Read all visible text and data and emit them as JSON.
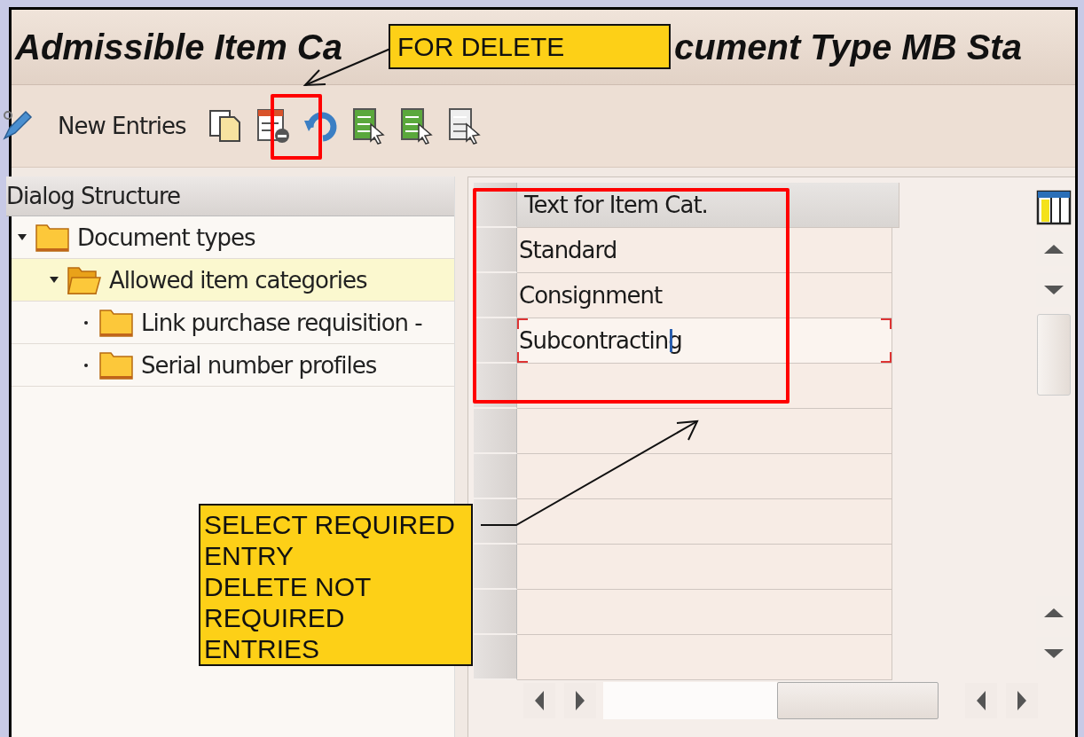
{
  "title": {
    "start": "Admissible Item Ca",
    "end": "cument Type MB Sta"
  },
  "toolbar": {
    "new_entries": "New Entries"
  },
  "dialog_structure": {
    "title": "Dialog Structure",
    "tree": [
      {
        "label": "Document types",
        "expanded": true,
        "selected": false,
        "children": [
          {
            "label": "Allowed item categories",
            "expanded": true,
            "selected": true,
            "children": [
              {
                "label": "Link purchase requisition -",
                "expanded": false,
                "selected": false
              },
              {
                "label": "Serial number profiles",
                "expanded": false,
                "selected": false
              }
            ]
          }
        ]
      }
    ]
  },
  "table": {
    "columns": [
      "Text for Item Cat."
    ],
    "rows": [
      {
        "text": "Standard",
        "focused": false
      },
      {
        "text": "Consignment",
        "focused": false
      },
      {
        "text": "Subcontracting",
        "focused": true
      }
    ]
  },
  "callouts": [
    {
      "text": "FOR DELETE"
    },
    {
      "text": "SELECT REQUIRED\nENTRY\nDELETE NOT\nREQUIRED\nENTRIES"
    }
  ]
}
